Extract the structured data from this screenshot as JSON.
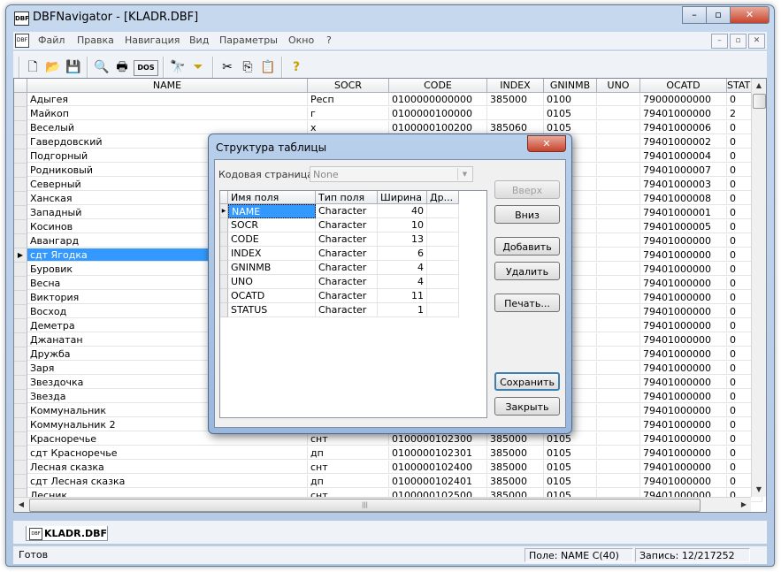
{
  "window": {
    "title": "DBFNavigator - [KLADR.DBF]",
    "app_icon_text": "DBF",
    "caption_buttons": [
      "–",
      "▫",
      "✕"
    ]
  },
  "menubar": {
    "doc_icon_text": "DBF",
    "items": [
      "Файл",
      "Правка",
      "Навигация",
      "Вид",
      "Параметры",
      "Окно",
      "?"
    ],
    "mdi_buttons": [
      "–",
      "▫",
      "✕"
    ]
  },
  "toolbar": {
    "icons": [
      "new-icon",
      "open-icon",
      "save-icon",
      "print-preview-icon",
      "print-icon",
      "dos-icon",
      "find-icon",
      "filter-icon",
      "cut-icon",
      "copy-icon",
      "paste-icon",
      "help-icon"
    ],
    "glyphs": [
      "🗋",
      "📂",
      "💾",
      "🔍",
      "🖶",
      "DOS",
      "🔭",
      "⏷",
      "✂",
      "⎘",
      "📋",
      "?"
    ]
  },
  "grid": {
    "columns": [
      "NAME",
      "SOCR",
      "CODE",
      "INDEX",
      "GNINMB",
      "UNO",
      "OCATD",
      "STATUS"
    ],
    "selected_row": 11,
    "rows": [
      [
        "Адыгея",
        "Респ",
        "0100000000000",
        "385000",
        "0100",
        "",
        "79000000000",
        "0"
      ],
      [
        "Майкоп",
        "г",
        "0100000100000",
        "",
        "0105",
        "",
        "79401000000",
        "2"
      ],
      [
        "Веселый",
        "х",
        "0100000100200",
        "385060",
        "0105",
        "",
        "79401000006",
        "0"
      ],
      [
        "Гавердовский",
        "",
        "",
        "",
        "",
        "",
        "79401000002",
        "0"
      ],
      [
        "Подгорный",
        "",
        "",
        "",
        "",
        "",
        "79401000004",
        "0"
      ],
      [
        "Родниковый",
        "",
        "",
        "",
        "",
        "",
        "79401000007",
        "0"
      ],
      [
        "Северный",
        "",
        "",
        "",
        "",
        "",
        "79401000003",
        "0"
      ],
      [
        "Ханская",
        "",
        "",
        "",
        "",
        "",
        "79401000008",
        "0"
      ],
      [
        "Западный",
        "",
        "",
        "",
        "",
        "",
        "79401000001",
        "0"
      ],
      [
        "Косинов",
        "",
        "",
        "",
        "",
        "",
        "79401000005",
        "0"
      ],
      [
        "Авангард",
        "",
        "",
        "",
        "",
        "",
        "79401000000",
        "0"
      ],
      [
        "сдт Ягодка",
        "",
        "",
        "",
        "",
        "",
        "79401000000",
        "0"
      ],
      [
        "Буровик",
        "",
        "",
        "",
        "",
        "",
        "79401000000",
        "0"
      ],
      [
        "Весна",
        "",
        "",
        "",
        "",
        "",
        "79401000000",
        "0"
      ],
      [
        "Виктория",
        "",
        "",
        "",
        "",
        "",
        "79401000000",
        "0"
      ],
      [
        "Восход",
        "",
        "",
        "",
        "",
        "",
        "79401000000",
        "0"
      ],
      [
        "Деметра",
        "",
        "",
        "",
        "",
        "",
        "79401000000",
        "0"
      ],
      [
        "Джанатан",
        "",
        "",
        "",
        "",
        "",
        "79401000000",
        "0"
      ],
      [
        "Дружба",
        "",
        "",
        "",
        "",
        "",
        "79401000000",
        "0"
      ],
      [
        "Заря",
        "",
        "",
        "",
        "",
        "",
        "79401000000",
        "0"
      ],
      [
        "Звездочка",
        "",
        "",
        "",
        "",
        "",
        "79401000000",
        "0"
      ],
      [
        "Звезда",
        "",
        "",
        "",
        "",
        "",
        "79401000000",
        "0"
      ],
      [
        "Коммунальник",
        "",
        "",
        "",
        "",
        "",
        "79401000000",
        "0"
      ],
      [
        "Коммунальник 2",
        "",
        "",
        "",
        "",
        "",
        "79401000000",
        "0"
      ],
      [
        "Красноречье",
        "снт",
        "0100000102300",
        "385000",
        "0105",
        "",
        "79401000000",
        "0"
      ],
      [
        "сдт Красноречье",
        "дп",
        "0100000102301",
        "385000",
        "0105",
        "",
        "79401000000",
        "0"
      ],
      [
        "Лесная сказка",
        "снт",
        "0100000102400",
        "385000",
        "0105",
        "",
        "79401000000",
        "0"
      ],
      [
        "сдт Лесная сказка",
        "дп",
        "0100000102401",
        "385000",
        "0105",
        "",
        "79401000000",
        "0"
      ],
      [
        "Лесник",
        "снт",
        "0100000102500",
        "385000",
        "0105",
        "",
        "79401000000",
        "0"
      ]
    ],
    "hscroll_grip": "|||"
  },
  "tab": {
    "label": "KLADR.DBF",
    "icon_text": "DBF"
  },
  "statusbar": {
    "ready": "Готов",
    "field": "Поле: NAME C(40)",
    "record": "Запись: 12/217252"
  },
  "dialog": {
    "title": "Структура таблицы",
    "close_label": "✕",
    "codepage_label": "Кодовая страница:",
    "codepage_value": "None",
    "columns": [
      "Имя поля",
      "Тип поля",
      "Ширина",
      "Др..."
    ],
    "selected_row": 0,
    "fields": [
      [
        "NAME",
        "Character",
        "40",
        ""
      ],
      [
        "SOCR",
        "Character",
        "10",
        ""
      ],
      [
        "CODE",
        "Character",
        "13",
        ""
      ],
      [
        "INDEX",
        "Character",
        "6",
        ""
      ],
      [
        "GNINMB",
        "Character",
        "4",
        ""
      ],
      [
        "UNO",
        "Character",
        "4",
        ""
      ],
      [
        "OCATD",
        "Character",
        "11",
        ""
      ],
      [
        "STATUS",
        "Character",
        "1",
        ""
      ]
    ],
    "buttons": {
      "up": "Вверх",
      "down": "Вниз",
      "add": "Добавить",
      "delete": "Удалить",
      "print": "Печать...",
      "save": "Сохранить",
      "close": "Закрыть"
    }
  }
}
